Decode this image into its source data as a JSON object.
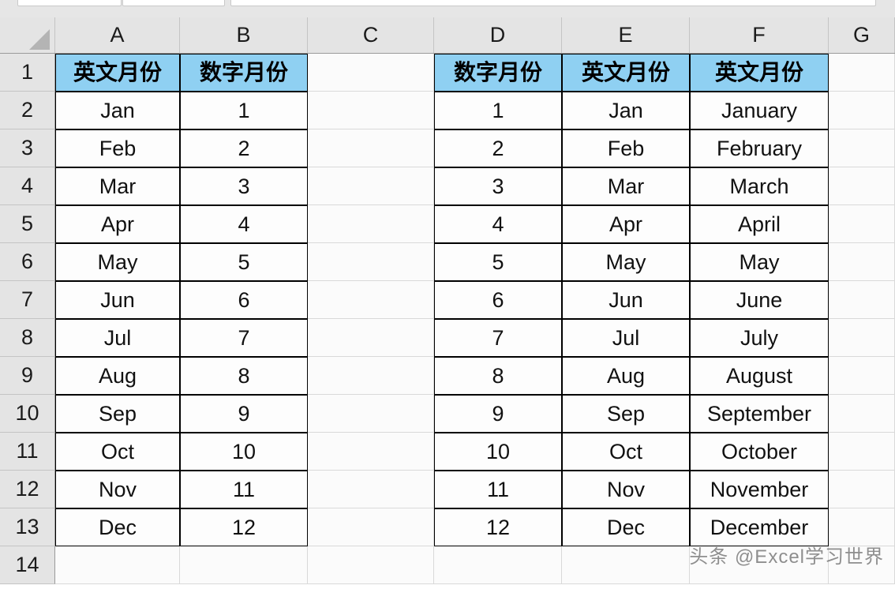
{
  "app": {
    "type": "spreadsheet",
    "watermark": "头条 @Excel学习世界"
  },
  "grid": {
    "column_headers": [
      "A",
      "B",
      "C",
      "D",
      "E",
      "F",
      "G"
    ],
    "row_headers": [
      "1",
      "2",
      "3",
      "4",
      "5",
      "6",
      "7",
      "8",
      "9",
      "10",
      "11",
      "12",
      "13",
      "14"
    ],
    "header_fill": "#8fd0f2",
    "cell_fill": "#fdfdfd",
    "header_bar_fill": "#e4e4e4",
    "gridline": "#d9d9d9",
    "border": "#000000"
  },
  "table_left": {
    "columns": [
      "A",
      "B"
    ],
    "headers": [
      "英文月份",
      "数字月份"
    ],
    "rows": [
      {
        "row": "2",
        "a": "Jan",
        "b": "1"
      },
      {
        "row": "3",
        "a": "Feb",
        "b": "2"
      },
      {
        "row": "4",
        "a": "Mar",
        "b": "3"
      },
      {
        "row": "5",
        "a": "Apr",
        "b": "4"
      },
      {
        "row": "6",
        "a": "May",
        "b": "5"
      },
      {
        "row": "7",
        "a": "Jun",
        "b": "6"
      },
      {
        "row": "8",
        "a": "Jul",
        "b": "7"
      },
      {
        "row": "9",
        "a": "Aug",
        "b": "8"
      },
      {
        "row": "10",
        "a": "Sep",
        "b": "9"
      },
      {
        "row": "11",
        "a": "Oct",
        "b": "10"
      },
      {
        "row": "12",
        "a": "Nov",
        "b": "11"
      },
      {
        "row": "13",
        "a": "Dec",
        "b": "12"
      }
    ]
  },
  "table_right": {
    "columns": [
      "D",
      "E",
      "F"
    ],
    "headers": [
      "数字月份",
      "英文月份",
      "英文月份"
    ],
    "rows": [
      {
        "row": "2",
        "d": "1",
        "e": "Jan",
        "f": "January"
      },
      {
        "row": "3",
        "d": "2",
        "e": "Feb",
        "f": "February"
      },
      {
        "row": "4",
        "d": "3",
        "e": "Mar",
        "f": "March"
      },
      {
        "row": "5",
        "d": "4",
        "e": "Apr",
        "f": "April"
      },
      {
        "row": "6",
        "d": "5",
        "e": "May",
        "f": "May"
      },
      {
        "row": "7",
        "d": "6",
        "e": "Jun",
        "f": "June"
      },
      {
        "row": "8",
        "d": "7",
        "e": "Jul",
        "f": "July"
      },
      {
        "row": "9",
        "d": "8",
        "e": "Aug",
        "f": "August"
      },
      {
        "row": "10",
        "d": "9",
        "e": "Sep",
        "f": "September"
      },
      {
        "row": "11",
        "d": "10",
        "e": "Oct",
        "f": "October"
      },
      {
        "row": "12",
        "d": "11",
        "e": "Nov",
        "f": "November"
      },
      {
        "row": "13",
        "d": "12",
        "e": "Dec",
        "f": "December"
      }
    ]
  }
}
